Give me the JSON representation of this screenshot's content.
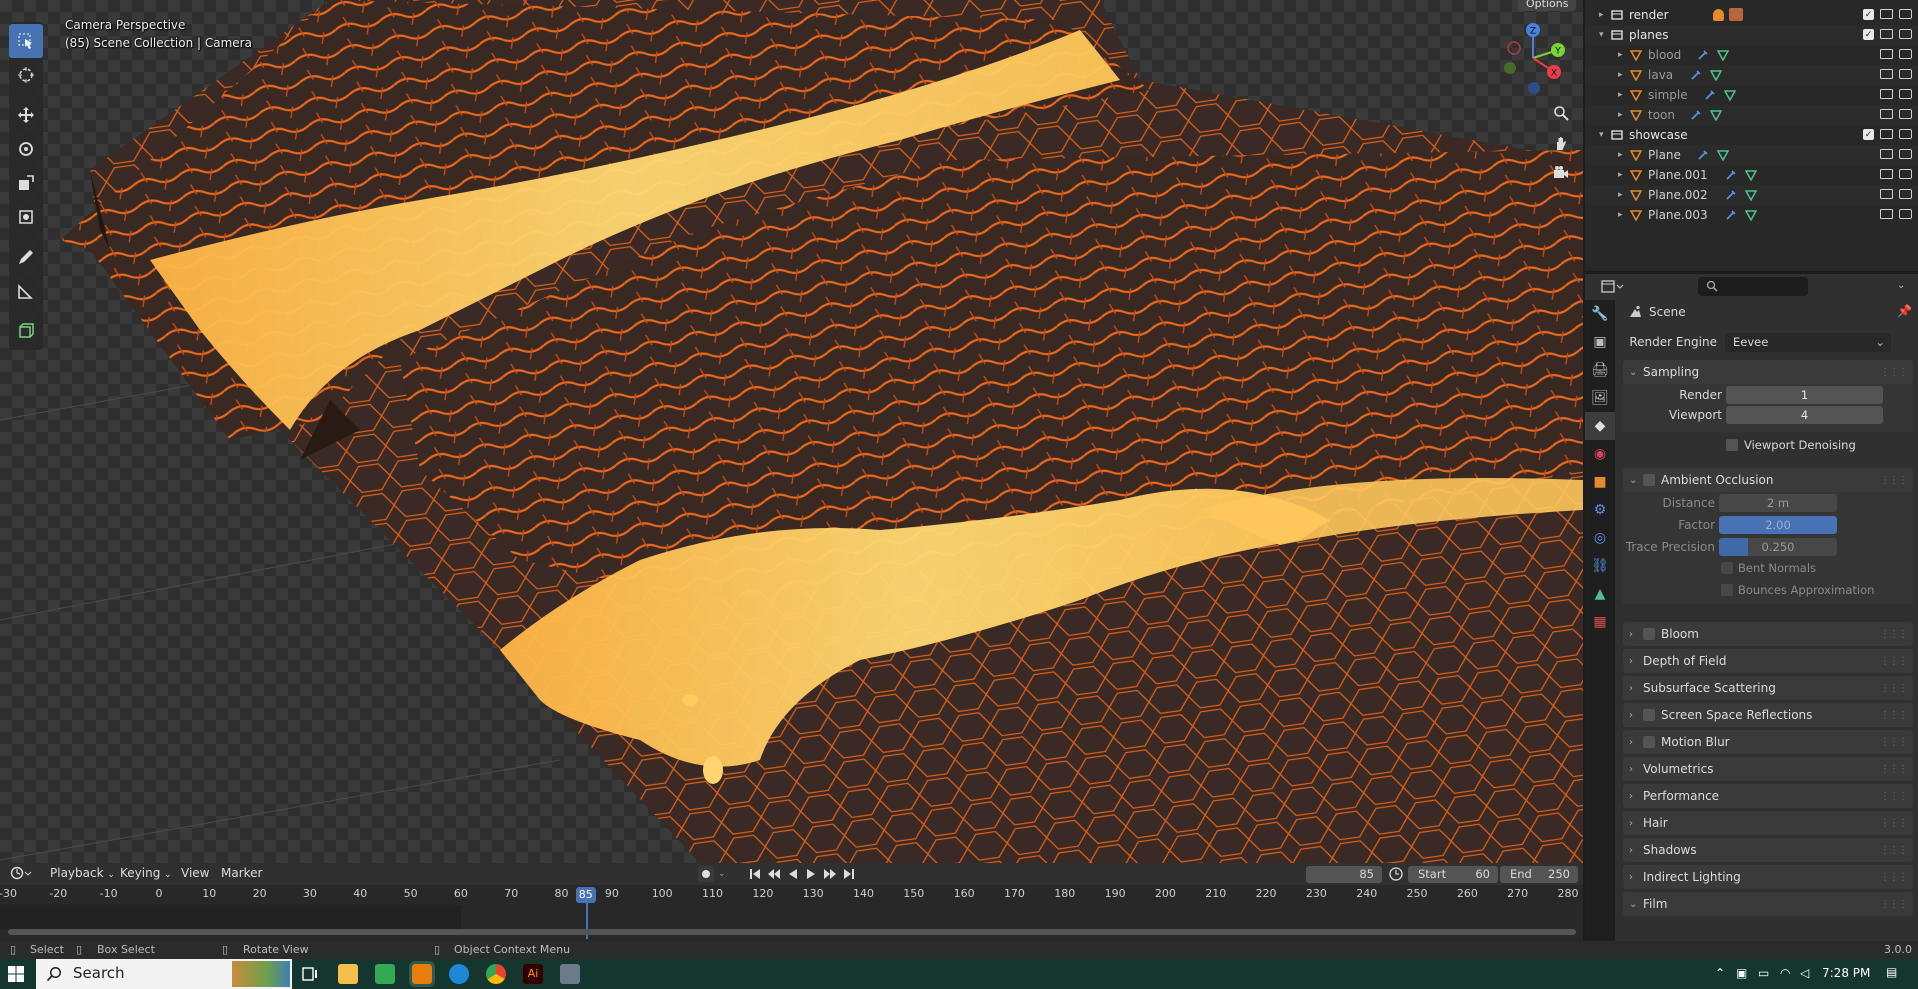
{
  "viewport": {
    "mode_label": "Camera Perspective",
    "collection_label": "(85) Scene Collection | Camera",
    "options_label": "Options",
    "gizmo_axes": [
      "Z",
      "Y",
      "X"
    ]
  },
  "toolbar": {
    "tools": [
      "select-box-icon",
      "cursor-icon",
      "move-icon",
      "rotate-icon",
      "scale-icon",
      "transform-icon",
      "annotate-icon",
      "measure-icon",
      "add-cube-icon"
    ]
  },
  "outliner": {
    "items": [
      {
        "label": "render",
        "indent": 1
      },
      {
        "label": "planes",
        "indent": 1
      },
      {
        "label": "blood",
        "indent": 2
      },
      {
        "label": "lava",
        "indent": 2
      },
      {
        "label": "simple",
        "indent": 2
      },
      {
        "label": "toon",
        "indent": 2
      },
      {
        "label": "showcase",
        "indent": 1
      },
      {
        "label": "Plane",
        "indent": 2
      },
      {
        "label": "Plane.001",
        "indent": 2
      },
      {
        "label": "Plane.002",
        "indent": 2
      },
      {
        "label": "Plane.003",
        "indent": 2
      }
    ]
  },
  "properties": {
    "search_placeholder": "",
    "context_label": "Scene",
    "render_engine_label": "Render Engine",
    "render_engine_value": "Eevee",
    "sampling": {
      "title": "Sampling",
      "render_label": "Render",
      "render_value": "1",
      "viewport_label": "Viewport",
      "viewport_value": "4",
      "denoise_label": "Viewport Denoising"
    },
    "ao": {
      "title": "Ambient Occlusion",
      "distance_label": "Distance",
      "distance_value": "2 m",
      "factor_label": "Factor",
      "factor_value": "2.00",
      "trace_label": "Trace Precision",
      "trace_value": "0.250",
      "bent_label": "Bent Normals",
      "bounces_label": "Bounces Approximation"
    },
    "panels": [
      {
        "label": "Bloom",
        "checkbox": true
      },
      {
        "label": "Depth of Field",
        "checkbox": false
      },
      {
        "label": "Subsurface Scattering",
        "checkbox": false
      },
      {
        "label": "Screen Space Reflections",
        "checkbox": true
      },
      {
        "label": "Motion Blur",
        "checkbox": true
      },
      {
        "label": "Volumetrics",
        "checkbox": false
      },
      {
        "label": "Performance",
        "checkbox": false
      },
      {
        "label": "Hair",
        "checkbox": false
      },
      {
        "label": "Shadows",
        "checkbox": false
      },
      {
        "label": "Indirect Lighting",
        "checkbox": false
      },
      {
        "label": "Film",
        "checkbox": false
      }
    ]
  },
  "timeline": {
    "menus": {
      "playback": "Playback",
      "keying": "Keying",
      "view": "View",
      "marker": "Marker"
    },
    "current_frame": "85",
    "start_label": "Start",
    "start_value": "60",
    "end_label": "End",
    "end_value": "250",
    "ticks": [
      "-30",
      "-20",
      "-10",
      "0",
      "10",
      "20",
      "30",
      "40",
      "50",
      "60",
      "70",
      "80",
      "90",
      "100",
      "110",
      "120",
      "130",
      "140",
      "150",
      "160",
      "170",
      "180",
      "190",
      "200",
      "210",
      "220",
      "230",
      "240",
      "250",
      "260",
      "270",
      "280"
    ],
    "playhead": "85"
  },
  "status": {
    "select": "Select",
    "box_select": "Box Select",
    "rotate_view": "Rotate View",
    "context_menu": "Object Context Menu",
    "version": "3.0.0"
  },
  "taskbar": {
    "search_label": "Search",
    "clock": "7:28 PM"
  }
}
